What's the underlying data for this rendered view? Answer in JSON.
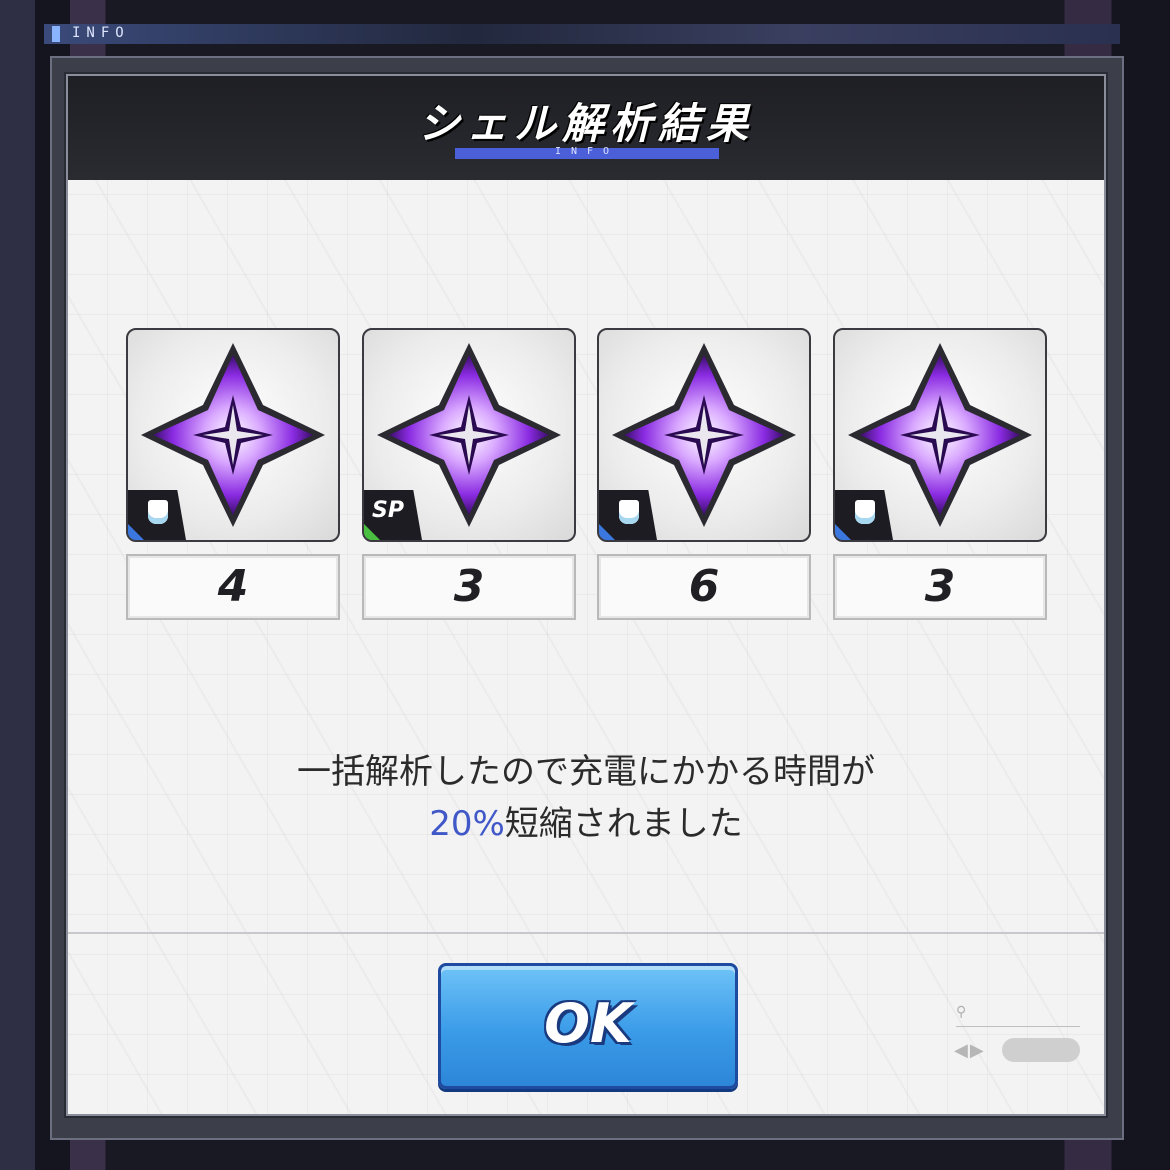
{
  "top_strip": {
    "label": "INFO"
  },
  "dialog": {
    "title": "シェル解析結果",
    "title_sub": "INFO",
    "items": [
      {
        "badge": "shield",
        "count": "4"
      },
      {
        "badge": "SP",
        "count": "3"
      },
      {
        "badge": "shield",
        "count": "6"
      },
      {
        "badge": "shield",
        "count": "3"
      }
    ],
    "message_line1": "一括解析したので充電にかかる時間が",
    "message_percent": "20%",
    "message_line2": "短縮されました",
    "ok_label": "OK"
  },
  "colors": {
    "accent_blue": "#4058c8",
    "title_bar": "#4a5fd8",
    "ok_button": "#3a9be8",
    "shell_purple": "#8a2be2"
  }
}
